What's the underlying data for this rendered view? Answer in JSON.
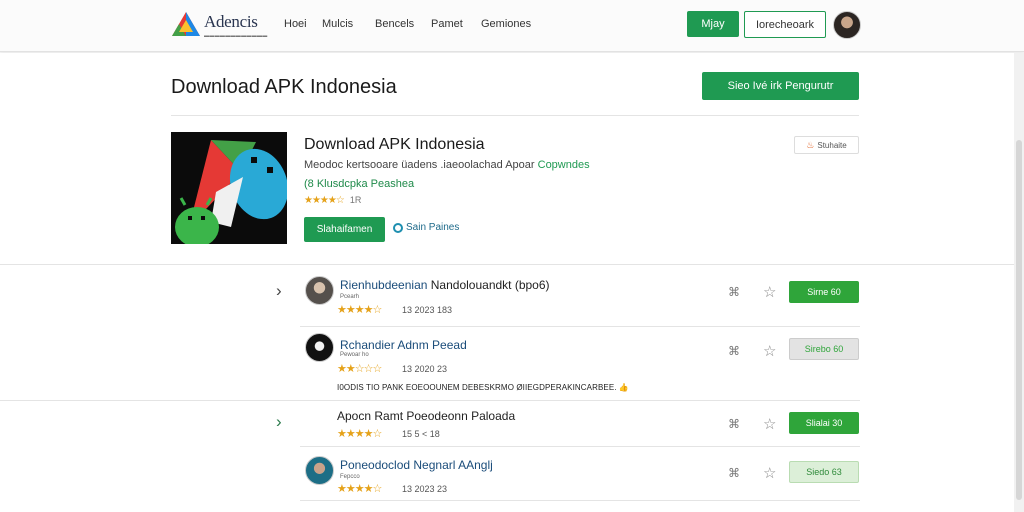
{
  "header": {
    "brand_name": "Adencis",
    "nav": [
      "Hoei",
      "Mulcis",
      "Bencels",
      "Pamet",
      "Gemiones"
    ],
    "primary_button": "Mjay",
    "secondary_button": "Iorecheoark"
  },
  "page": {
    "title": "Download APK Indonesia",
    "top_button": "Sieo Ivé irk Pengurutr"
  },
  "app": {
    "title": "Download APK Indonesia",
    "description": "Meodoc kertsooare üadens .iaeoolachad Apoar",
    "description_highlight": "Copwndes",
    "subtitle": "(8 Klusdcpka Peashea",
    "stars": "★★★★☆",
    "rating_text": "1R",
    "install_button": "Slahaifamen",
    "share_link": "Sain Paines",
    "share_badge": "Stuhaite"
  },
  "reviews": [
    {
      "name": "Rienhubdeenian",
      "name_rest": "Nandolouandkt (bpo6)",
      "sub": "Pcearh",
      "stars": "★★★★☆",
      "meta": "13 2023 183",
      "button": "Sirne 60",
      "button_style": "green"
    },
    {
      "name": "Rchandier Adnm Peead",
      "sub": "Pewoar ho",
      "stars": "★★☆☆☆",
      "meta": "13 2020 23",
      "comment": "I0ODIS TIO PANK EOEOOUNEM DEBESKRMO ØIIEGDPERAKINCARBEE.",
      "comment_emoji": "👍",
      "button": "Sirebo 60",
      "button_style": "grey"
    },
    {
      "name": "Apocn Ramt Poeodeonn Paloada",
      "stars": "★★★★☆",
      "meta": "15 5 < 18",
      "button": "Slialai 30",
      "button_style": "green"
    },
    {
      "name": "Poneodoclod Negnarl AAnglj",
      "sub": "Fepcco",
      "stars": "★★★★☆",
      "meta": "13 2023 23",
      "button": "Siedo 63",
      "button_style": "pale"
    }
  ],
  "colors": {
    "brand_green": "#1f9a52",
    "row_button_green": "#2fa53a",
    "link_blue": "#1a4c7a",
    "star_gold": "#e5a21a"
  },
  "icons": [
    "brand-logo-icon",
    "chevron-right-icon",
    "tag-icon",
    "star-outline-icon",
    "share-icon"
  ]
}
